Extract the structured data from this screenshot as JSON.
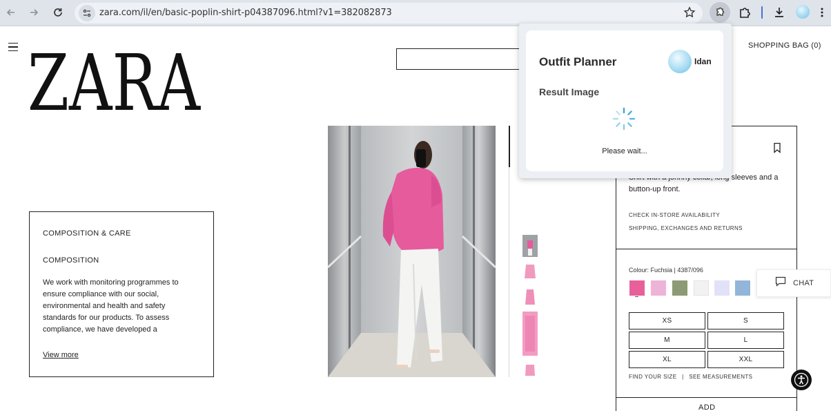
{
  "browser": {
    "url": "zara.com/il/en/basic-poplin-shirt-p04387096.html?v1=382082873",
    "icons": [
      "back-arrow-icon",
      "forward-arrow-icon",
      "reload-icon",
      "site-info-icon",
      "bookmark-star-icon",
      "extension-puzzle-icon",
      "extensions-icon",
      "download-icon",
      "profile-avatar",
      "more-menu-icon"
    ]
  },
  "header": {
    "logo": "ZARA",
    "shopping_bag": "SHOPPING BAG (0)"
  },
  "composition": {
    "heading": "COMPOSITION & CARE",
    "subheading": "COMPOSITION",
    "text": "We work with monitoring programmes to ensure compliance with our social, environmental and health and safety standards for our products. To assess compliance, we have developed a",
    "view_more": "View more"
  },
  "product": {
    "description": "Shirt with a johnny collar, long sleeves and a button-up front.",
    "check_store": "CHECK IN-STORE AVAILABILITY",
    "shipping": "SHIPPING, EXCHANGES AND RETURNS",
    "colour_label": "Colour: Fuchsia | 4387/096",
    "swatches": [
      "#e8609a",
      "#eeb4d7",
      "#8c9a75",
      "#f2f2f2",
      "#e1e1f7",
      "#92b5d9"
    ],
    "sizes": [
      "XS",
      "S",
      "M",
      "L",
      "XL",
      "XXL"
    ],
    "find_your_size": "FIND YOUR SIZE",
    "separator": "|",
    "see_measurements": "SEE MEASUREMENTS",
    "add": "ADD",
    "chat": "CHAT"
  },
  "popup": {
    "title": "Outfit Planner",
    "user": "Idan",
    "subtitle": "Result Image",
    "status": "Please wait..."
  }
}
